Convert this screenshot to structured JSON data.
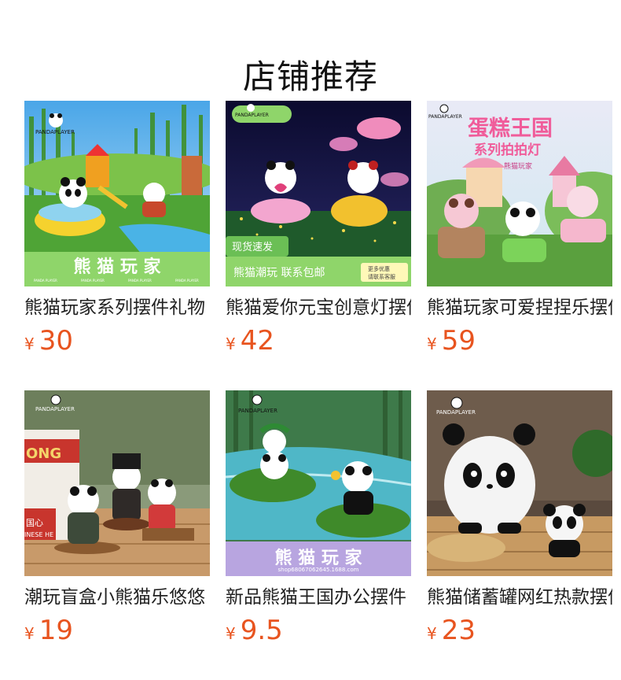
{
  "section": {
    "title": "店铺推荐"
  },
  "products": [
    {
      "name": "熊猫玩家系列摆件礼物",
      "currency": "¥",
      "price": "30",
      "image": {
        "brand": "PANDAPLAYER",
        "banner": "熊 猫 玩 家",
        "banner_sub": [
          "PANDA PLAYER",
          "PANDA PLAYER",
          "PANDA PLAYER",
          "PANDA PLAYER"
        ]
      }
    },
    {
      "name": "熊猫爱你元宝创意灯摆件",
      "currency": "¥",
      "price": "42",
      "image": {
        "brand": "PANDAPLAYER",
        "tag": "现货速发",
        "bottom_text": "熊猫潮玩  联系包邮",
        "badge": "更多优惠\n请联系客服"
      }
    },
    {
      "name": "熊猫玩家可爱捏捏乐摆件",
      "currency": "¥",
      "price": "59",
      "image": {
        "brand": "PANDAPLAYER",
        "headline": "蛋糕王国",
        "subline": "系列拍拍灯",
        "small": "熊猫玩家"
      }
    },
    {
      "name": "潮玩盲盒小熊猫乐悠悠",
      "currency": "¥",
      "price": "19",
      "image": {
        "brand": "PANDAPLAYER",
        "sign": "ONG",
        "side": "国心",
        "side2": "INESE HE"
      }
    },
    {
      "name": "新品熊猫王国办公摆件",
      "currency": "¥",
      "price": "9.5",
      "image": {
        "brand": "PANDAPLAYER",
        "banner": "熊 猫 玩 家",
        "watermark": "shop68067062645.1688.com"
      }
    },
    {
      "name": "熊猫储蓄罐网红热款摆件",
      "currency": "¥",
      "price": "23",
      "image": {
        "brand": "PANDAPLAYER"
      }
    }
  ]
}
